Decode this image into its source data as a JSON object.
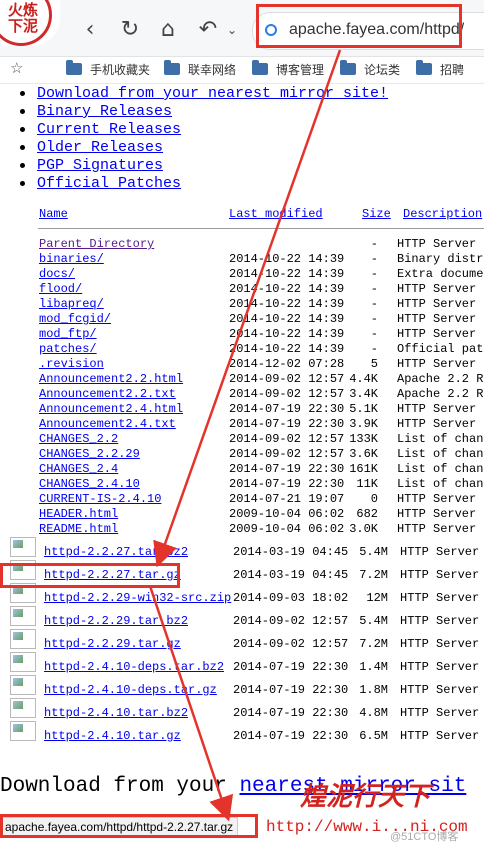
{
  "toolbar": {
    "logo_text_line1": "火炼",
    "logo_text_line2": "下泥",
    "back": "‹",
    "reload": "↻",
    "home": "⌂",
    "undo": "↶",
    "url": "apache.fayea.com/httpd/"
  },
  "bookmarks": [
    {
      "label": "手机收藏夹"
    },
    {
      "label": "联幸网络"
    },
    {
      "label": "博客管理"
    },
    {
      "label": "论坛类"
    },
    {
      "label": "招聘"
    }
  ],
  "links": [
    "Download from your nearest mirror site!",
    "Binary Releases",
    "Current Releases",
    "Older Releases",
    "PGP Signatures",
    "Official Patches"
  ],
  "table": {
    "headers": {
      "name": "Name",
      "modified": "Last modified",
      "size": "Size",
      "description": "Description"
    },
    "rows": [
      {
        "name": "Parent Directory",
        "date": "",
        "size": "-",
        "desc": "HTTP Server"
      },
      {
        "name": "binaries/",
        "date": "2014-10-22 14:39",
        "size": "-",
        "desc": "Binary distr"
      },
      {
        "name": "docs/",
        "date": "2014-10-22 14:39",
        "size": "-",
        "desc": "Extra docume"
      },
      {
        "name": "flood/",
        "date": "2014-10-22 14:39",
        "size": "-",
        "desc": "HTTP Server"
      },
      {
        "name": "libapreq/",
        "date": "2014-10-22 14:39",
        "size": "-",
        "desc": "HTTP Server"
      },
      {
        "name": "mod_fcgid/",
        "date": "2014-10-22 14:39",
        "size": "-",
        "desc": "HTTP Server"
      },
      {
        "name": "mod_ftp/",
        "date": "2014-10-22 14:39",
        "size": "-",
        "desc": "HTTP Server"
      },
      {
        "name": "patches/",
        "date": "2014-10-22 14:39",
        "size": "-",
        "desc": "Official pat"
      },
      {
        "name": ".revision",
        "date": "2014-12-02 07:28",
        "size": "5",
        "desc": "HTTP Server"
      },
      {
        "name": "Announcement2.2.html",
        "date": "2014-09-02 12:57",
        "size": "4.4K",
        "desc": "Apache 2.2 R"
      },
      {
        "name": "Announcement2.2.txt",
        "date": "2014-09-02 12:57",
        "size": "3.4K",
        "desc": "Apache 2.2 R"
      },
      {
        "name": "Announcement2.4.html",
        "date": "2014-07-19 22:30",
        "size": "5.1K",
        "desc": "HTTP Server"
      },
      {
        "name": "Announcement2.4.txt",
        "date": "2014-07-19 22:30",
        "size": "3.9K",
        "desc": "HTTP Server"
      },
      {
        "name": "CHANGES_2.2",
        "date": "2014-09-02 12:57",
        "size": "133K",
        "desc": "List of chan"
      },
      {
        "name": "CHANGES_2.2.29",
        "date": "2014-09-02 12:57",
        "size": "3.6K",
        "desc": "List of chan"
      },
      {
        "name": "CHANGES_2.4",
        "date": "2014-07-19 22:30",
        "size": "161K",
        "desc": "List of chan"
      },
      {
        "name": "CHANGES_2.4.10",
        "date": "2014-07-19 22:30",
        "size": "11K",
        "desc": "List of chan"
      },
      {
        "name": "CURRENT-IS-2.4.10",
        "date": "2014-07-21 19:07",
        "size": "0",
        "desc": "HTTP Server"
      },
      {
        "name": "HEADER.html",
        "date": "2009-10-04 06:02",
        "size": "682",
        "desc": "HTTP Server"
      },
      {
        "name": "README.html",
        "date": "2009-10-04 06:02",
        "size": "3.0K",
        "desc": "HTTP Server"
      }
    ],
    "files": [
      {
        "name": "httpd-2.2.27.tar.bz2",
        "date": "2014-03-19 04:45",
        "size": "5.4M",
        "desc": "HTTP Server"
      },
      {
        "name": "httpd-2.2.27.tar.gz",
        "date": "2014-03-19 04:45",
        "size": "7.2M",
        "desc": "HTTP Server"
      },
      {
        "name": "httpd-2.2.29-win32-src.zip",
        "date": "2014-09-03 18:02",
        "size": "12M",
        "desc": "HTTP Server"
      },
      {
        "name": "httpd-2.2.29.tar.bz2",
        "date": "2014-09-02 12:57",
        "size": "5.4M",
        "desc": "HTTP Server"
      },
      {
        "name": "httpd-2.2.29.tar.gz",
        "date": "2014-09-02 12:57",
        "size": "7.2M",
        "desc": "HTTP Server"
      },
      {
        "name": "httpd-2.4.10-deps.tar.bz2",
        "date": "2014-07-19 22:30",
        "size": "1.4M",
        "desc": "HTTP Server"
      },
      {
        "name": "httpd-2.4.10-deps.tar.gz",
        "date": "2014-07-19 22:30",
        "size": "1.8M",
        "desc": "HTTP Server"
      },
      {
        "name": "httpd-2.4.10.tar.bz2",
        "date": "2014-07-19 22:30",
        "size": "4.8M",
        "desc": "HTTP Server"
      },
      {
        "name": "httpd-2.4.10.tar.gz",
        "date": "2014-07-19 22:30",
        "size": "6.5M",
        "desc": "HTTP Server"
      }
    ]
  },
  "footer": {
    "download_prefix": "Download from your ",
    "download_link": "nearest mirror sit"
  },
  "watermark": {
    "cn": "煌泥行天下",
    "url": "http://www.i...ni.com",
    "small": "@51CTO博客"
  },
  "status_bar": "apache.fayea.com/httpd/httpd-2.2.27.tar.gz",
  "colors": {
    "highlight": "#e4332b",
    "link": "#0000ee",
    "visited": "#551a8b"
  }
}
